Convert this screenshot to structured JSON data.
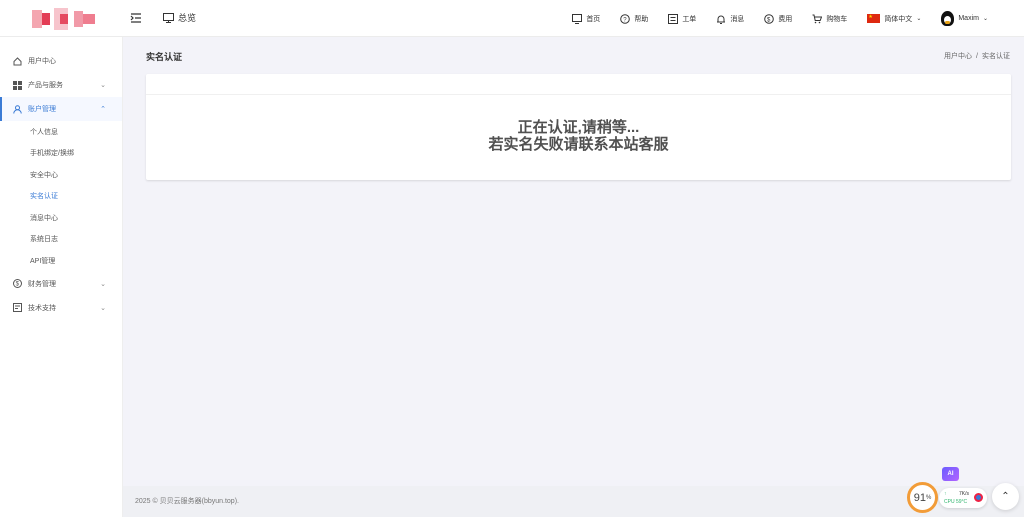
{
  "header": {
    "overview_label": "总览",
    "nav": [
      {
        "label": "首页",
        "icon": "home-monitor-icon"
      },
      {
        "label": "帮助",
        "icon": "help-icon"
      },
      {
        "label": "工单",
        "icon": "ticket-icon"
      },
      {
        "label": "消息",
        "icon": "bell-icon"
      },
      {
        "label": "费用",
        "icon": "dollar-icon"
      },
      {
        "label": "购物车",
        "icon": "cart-icon"
      }
    ],
    "language": "简体中文",
    "username": "Maxim"
  },
  "sidebar": {
    "items": [
      {
        "label": "用户中心",
        "icon": "home-icon"
      },
      {
        "label": "产品与服务",
        "icon": "grid-icon"
      },
      {
        "label": "账户管理",
        "icon": "user-icon"
      },
      {
        "label": "财务管理",
        "icon": "dollar-icon"
      },
      {
        "label": "技术支持",
        "icon": "support-icon"
      }
    ],
    "sub_items": [
      "个人信息",
      "手机绑定/换绑",
      "安全中心",
      "实名认证",
      "消息中心",
      "系统日志",
      "API管理"
    ]
  },
  "page": {
    "title": "实名认证",
    "breadcrumb": [
      "用户中心",
      "实名认证"
    ],
    "message_line1": "正在认证,请稍等...",
    "message_line2": "若实名失败请联系本站客服"
  },
  "footer": {
    "text": "2025 © 贝贝云服务器(bbyun.top)."
  },
  "widgets": {
    "ai_label": "AI",
    "gauge_value": "91",
    "gauge_unit": "%",
    "mon_up": "↑",
    "mon_pct": "7K/s",
    "mon_cpu": "CPU 59°C",
    "accent_color": "#3a7bd5",
    "gauge_color": "#f29c38"
  }
}
